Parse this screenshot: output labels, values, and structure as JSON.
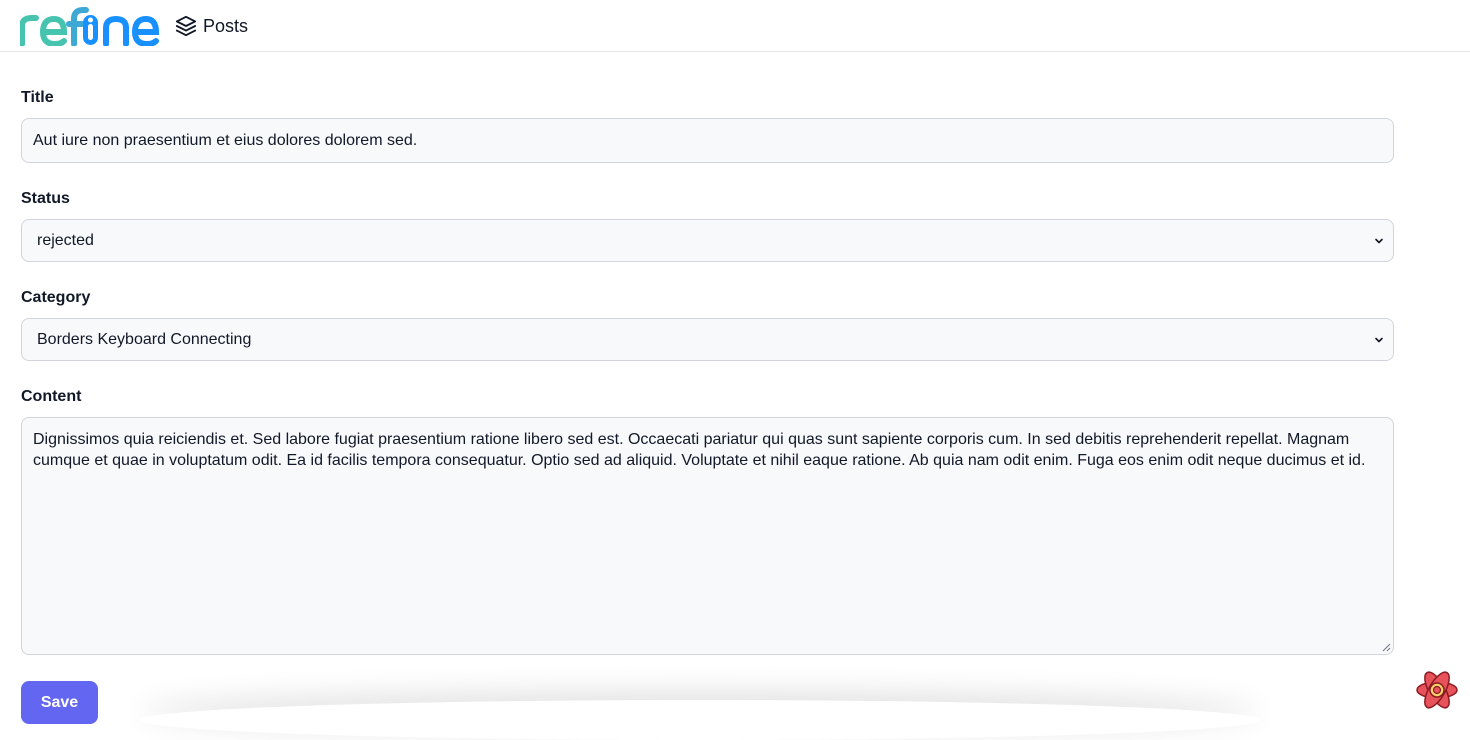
{
  "header": {
    "logo_text": "refine",
    "nav": [
      {
        "label": "Posts",
        "icon": "layers-icon"
      }
    ]
  },
  "form": {
    "title": {
      "label": "Title",
      "value": "Aut iure non praesentium et eius dolores dolorem sed."
    },
    "status": {
      "label": "Status",
      "value": "rejected"
    },
    "category": {
      "label": "Category",
      "value": "Borders Keyboard Connecting"
    },
    "content": {
      "label": "Content",
      "value": "Dignissimos quia reiciendis et. Sed labore fugiat praesentium ratione libero sed est. Occaecati pariatur qui quas sunt sapiente corporis cum. In sed debitis reprehenderit repellat. Magnam cumque et quae in voluptatum odit. Ea id facilis tempora consequatur. Optio sed ad aliquid. Voluptate et nihil eaque ratione. Ab quia nam odit enim. Fuga eos enim odit neque ducimus et id."
    },
    "save_label": "Save"
  },
  "colors": {
    "accent": "#6366f1",
    "logo_teal": "#47c4b0",
    "logo_blue": "#1890ff",
    "devtools_red": "#e8525a"
  }
}
